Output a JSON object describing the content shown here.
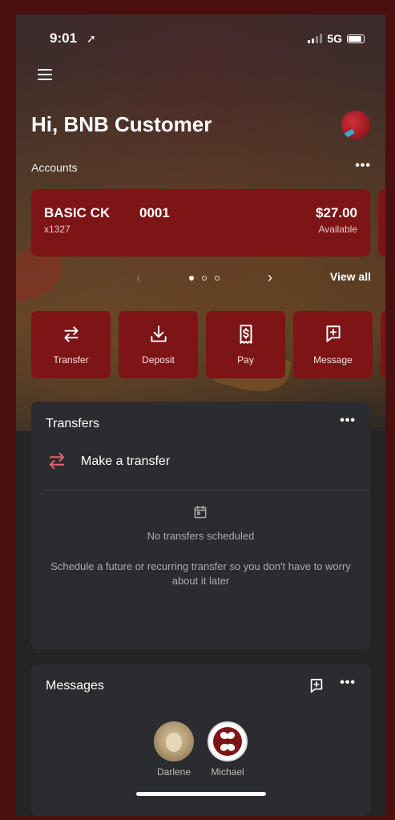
{
  "status": {
    "time": "9:01",
    "network": "5G"
  },
  "header": {
    "greeting": "Hi, BNB Customer"
  },
  "accounts": {
    "label": "Accounts",
    "more": "•••",
    "items": [
      {
        "name": "BASIC CK",
        "number": "x1327",
        "code": "0001",
        "amount": "$27.00",
        "status": "Available"
      }
    ],
    "view_all": "View all"
  },
  "actions": [
    {
      "label": "Transfer",
      "icon": "transfer-icon"
    },
    {
      "label": "Deposit",
      "icon": "deposit-icon"
    },
    {
      "label": "Pay",
      "icon": "pay-icon"
    },
    {
      "label": "Message",
      "icon": "message-icon"
    }
  ],
  "transfers": {
    "title": "Transfers",
    "more": "•••",
    "make": "Make a transfer",
    "empty_title": "No transfers scheduled",
    "empty_desc": "Schedule a future or recurring transfer so you don't have to worry about it later"
  },
  "messages": {
    "title": "Messages",
    "more": "•••",
    "contacts": [
      {
        "name": "Darlene"
      },
      {
        "name": "Michael"
      }
    ]
  },
  "colors": {
    "accent": "#7d1416",
    "background": "#222426",
    "card": "#2a2c2f",
    "icon_accent": "#e06070"
  }
}
